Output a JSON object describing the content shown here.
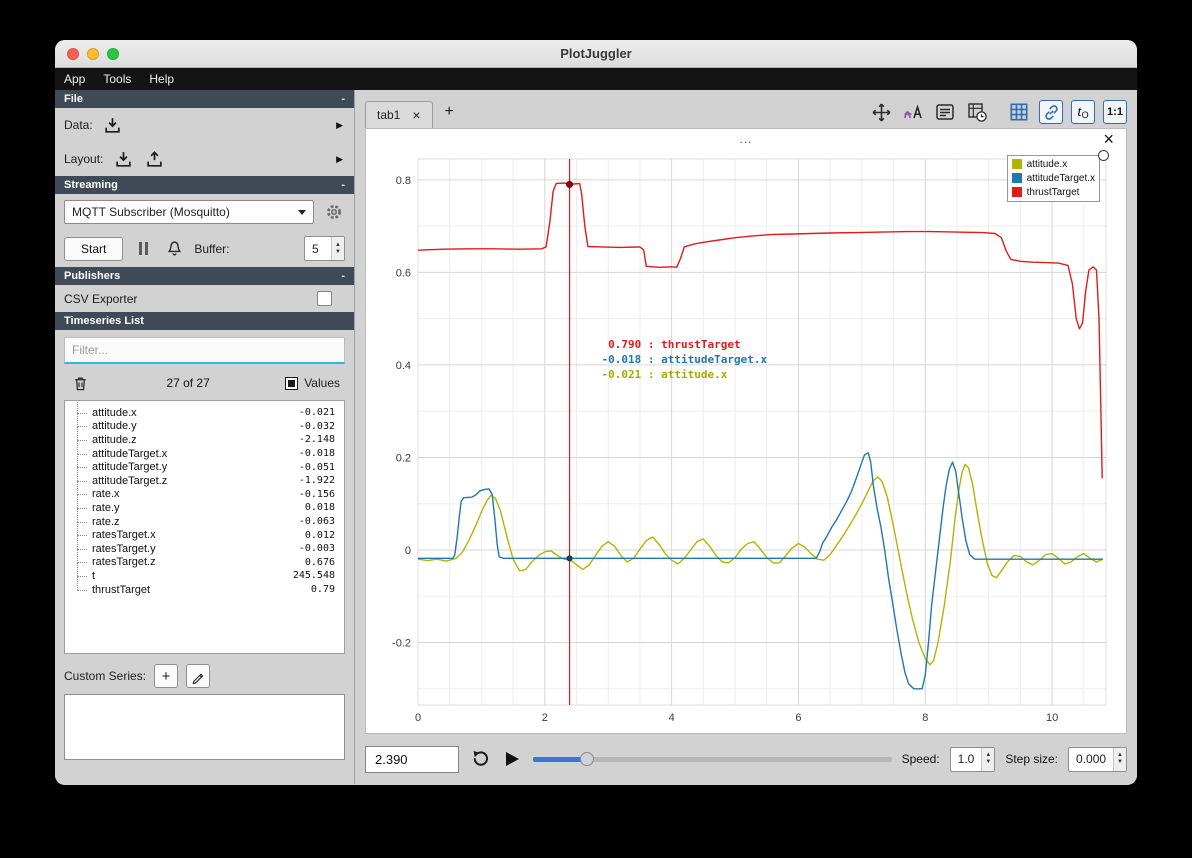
{
  "window": {
    "title": "PlotJuggler",
    "menu_items": [
      "App",
      "Tools",
      "Help"
    ]
  },
  "icons": {
    "close": "×",
    "plus": "+",
    "expander": "▶",
    "spin_up": "▲",
    "spin_down": "▼"
  },
  "sidebar": {
    "sections": {
      "file": {
        "title": "File",
        "collapse": "-"
      },
      "streaming": {
        "title": "Streaming",
        "collapse": "-"
      },
      "publishers": {
        "title": "Publishers",
        "collapse": "-"
      },
      "timeseries": {
        "title": "Timeseries List"
      }
    },
    "file": {
      "data_label": "Data:",
      "layout_label": "Layout:"
    },
    "streaming": {
      "source_selected": "MQTT Subscriber (Mosquitto)",
      "start_button": "Start",
      "buffer_label": "Buffer:",
      "buffer_value": "5"
    },
    "publishers": {
      "csv_exporter_label": "CSV Exporter"
    },
    "timeseries": {
      "filter_placeholder": "Filter...",
      "count_text": "27 of 27",
      "values_label": "Values",
      "items": [
        {
          "name": "attitude.x",
          "value": "-0.021"
        },
        {
          "name": "attitude.y",
          "value": "-0.032"
        },
        {
          "name": "attitude.z",
          "value": "-2.148"
        },
        {
          "name": "attitudeTarget.x",
          "value": "-0.018"
        },
        {
          "name": "attitudeTarget.y",
          "value": "-0.051"
        },
        {
          "name": "attitudeTarget.z",
          "value": "-1.922"
        },
        {
          "name": "rate.x",
          "value": "-0.156"
        },
        {
          "name": "rate.y",
          "value": "0.018"
        },
        {
          "name": "rate.z",
          "value": "-0.063"
        },
        {
          "name": "ratesTarget.x",
          "value": "0.012"
        },
        {
          "name": "ratesTarget.y",
          "value": "-0.003"
        },
        {
          "name": "ratesTarget.z",
          "value": "0.676"
        },
        {
          "name": "t",
          "value": "245.548"
        },
        {
          "name": "thrustTarget",
          "value": "0.79"
        }
      ],
      "custom_series_label": "Custom Series:"
    }
  },
  "main": {
    "tabs": [
      {
        "label": "tab1"
      }
    ],
    "new_tab_label": "+",
    "toolbar": {
      "icon_names": [
        "pan-zoom",
        "text-style",
        "legend",
        "datetime",
        "grid",
        "link",
        "time-offset",
        "aspect-ratio"
      ],
      "t0_label": "t",
      "t0_sub": "O",
      "ratio_label": "1:1",
      "accent_color": "#2f6db8"
    },
    "plot": {
      "header_dots": "...",
      "legend": [
        {
          "label": "attitude.x",
          "color": "#b2b400"
        },
        {
          "label": "attitudeTarget.x",
          "color": "#1f77b4"
        },
        {
          "label": "thrustTarget",
          "color": "#e01b1b"
        }
      ],
      "tracker": {
        "time": 2.39,
        "readouts": [
          {
            "value": "0.790",
            "name": "thrustTarget",
            "color": "#e01b1b"
          },
          {
            "value": "-0.018",
            "name": "attitudeTarget.x",
            "color": "#1f77b4"
          },
          {
            "value": "-0.021",
            "name": "attitude.x",
            "color": "#a8aa00"
          }
        ]
      }
    }
  },
  "bottom_bar": {
    "time_value": "2.390",
    "speed_label": "Speed:",
    "speed_value": "1.0",
    "step_label": "Step size:",
    "step_value": "0.000"
  },
  "chart_data": {
    "type": "line",
    "title": "",
    "xlabel": "",
    "ylabel": "",
    "xlim": [
      0,
      10.85
    ],
    "ylim": [
      -0.335,
      0.845
    ],
    "x_ticks": [
      0,
      2,
      4,
      6,
      8,
      10
    ],
    "y_ticks": [
      -0.2,
      0,
      0.2,
      0.4,
      0.6,
      0.8
    ],
    "grid": true,
    "legend_position": "top-right",
    "tracker_x": 2.39,
    "tracker_dots": [
      {
        "y": 0.79,
        "fill": "#a40000",
        "stroke": "#5c0000",
        "r": 3
      },
      {
        "y": -0.018,
        "fill": "#16456e",
        "stroke": "#0c2c49",
        "r": 2.5
      }
    ],
    "series": [
      {
        "name": "attitude.x",
        "color": "#b2b400",
        "points": [
          [
            0,
            -0.02
          ],
          [
            0.15,
            -0.023
          ],
          [
            0.3,
            -0.02
          ],
          [
            0.45,
            -0.024
          ],
          [
            0.6,
            -0.018
          ],
          [
            0.7,
            -0.005
          ],
          [
            0.8,
            0.02
          ],
          [
            0.9,
            0.05
          ],
          [
            1.0,
            0.082
          ],
          [
            1.08,
            0.105
          ],
          [
            1.15,
            0.118
          ],
          [
            1.22,
            0.112
          ],
          [
            1.3,
            0.085
          ],
          [
            1.4,
            0.03
          ],
          [
            1.5,
            -0.02
          ],
          [
            1.6,
            -0.045
          ],
          [
            1.7,
            -0.042
          ],
          [
            1.8,
            -0.025
          ],
          [
            1.9,
            -0.012
          ],
          [
            2.0,
            -0.004
          ],
          [
            2.1,
            -0.002
          ],
          [
            2.2,
            -0.012
          ],
          [
            2.3,
            -0.02
          ],
          [
            2.4,
            -0.021
          ],
          [
            2.5,
            -0.032
          ],
          [
            2.6,
            -0.042
          ],
          [
            2.7,
            -0.032
          ],
          [
            2.8,
            -0.012
          ],
          [
            2.9,
            0.008
          ],
          [
            3.0,
            0.018
          ],
          [
            3.1,
            0.008
          ],
          [
            3.2,
            -0.012
          ],
          [
            3.3,
            -0.026
          ],
          [
            3.4,
            -0.018
          ],
          [
            3.5,
            0.002
          ],
          [
            3.6,
            0.02
          ],
          [
            3.7,
            0.028
          ],
          [
            3.8,
            0.012
          ],
          [
            3.9,
            -0.008
          ],
          [
            4.0,
            -0.022
          ],
          [
            4.1,
            -0.03
          ],
          [
            4.2,
            -0.018
          ],
          [
            4.3,
            0.0
          ],
          [
            4.4,
            0.018
          ],
          [
            4.5,
            0.024
          ],
          [
            4.6,
            0.008
          ],
          [
            4.7,
            -0.012
          ],
          [
            4.8,
            -0.026
          ],
          [
            4.9,
            -0.028
          ],
          [
            5.0,
            -0.016
          ],
          [
            5.1,
            0.002
          ],
          [
            5.2,
            0.014
          ],
          [
            5.3,
            0.018
          ],
          [
            5.4,
            0.002
          ],
          [
            5.5,
            -0.016
          ],
          [
            5.6,
            -0.028
          ],
          [
            5.7,
            -0.028
          ],
          [
            5.8,
            -0.012
          ],
          [
            5.9,
            0.004
          ],
          [
            6.0,
            0.014
          ],
          [
            6.1,
            0.006
          ],
          [
            6.2,
            -0.008
          ],
          [
            6.3,
            -0.02
          ],
          [
            6.4,
            -0.022
          ],
          [
            6.5,
            -0.01
          ],
          [
            6.6,
            0.01
          ],
          [
            6.7,
            0.03
          ],
          [
            6.8,
            0.052
          ],
          [
            6.9,
            0.075
          ],
          [
            7.0,
            0.1
          ],
          [
            7.1,
            0.128
          ],
          [
            7.18,
            0.15
          ],
          [
            7.25,
            0.158
          ],
          [
            7.32,
            0.148
          ],
          [
            7.4,
            0.115
          ],
          [
            7.5,
            0.05
          ],
          [
            7.6,
            -0.02
          ],
          [
            7.7,
            -0.09
          ],
          [
            7.8,
            -0.15
          ],
          [
            7.9,
            -0.2
          ],
          [
            8.0,
            -0.235
          ],
          [
            8.07,
            -0.248
          ],
          [
            8.13,
            -0.24
          ],
          [
            8.2,
            -0.2
          ],
          [
            8.3,
            -0.12
          ],
          [
            8.4,
            -0.02
          ],
          [
            8.47,
            0.07
          ],
          [
            8.53,
            0.13
          ],
          [
            8.58,
            0.168
          ],
          [
            8.63,
            0.185
          ],
          [
            8.68,
            0.178
          ],
          [
            8.75,
            0.14
          ],
          [
            8.82,
            0.08
          ],
          [
            8.9,
            0.02
          ],
          [
            8.98,
            -0.03
          ],
          [
            9.05,
            -0.055
          ],
          [
            9.12,
            -0.06
          ],
          [
            9.2,
            -0.045
          ],
          [
            9.3,
            -0.025
          ],
          [
            9.4,
            -0.012
          ],
          [
            9.5,
            -0.014
          ],
          [
            9.6,
            -0.026
          ],
          [
            9.7,
            -0.032
          ],
          [
            9.8,
            -0.022
          ],
          [
            9.9,
            -0.01
          ],
          [
            10.0,
            -0.008
          ],
          [
            10.1,
            -0.018
          ],
          [
            10.2,
            -0.03
          ],
          [
            10.3,
            -0.026
          ],
          [
            10.4,
            -0.014
          ],
          [
            10.5,
            -0.008
          ],
          [
            10.6,
            -0.018
          ],
          [
            10.7,
            -0.026
          ],
          [
            10.8,
            -0.02
          ]
        ]
      },
      {
        "name": "attitudeTarget.x",
        "color": "#1f77b4",
        "points": [
          [
            0,
            -0.018
          ],
          [
            0.55,
            -0.018
          ],
          [
            0.58,
            -0.01
          ],
          [
            0.62,
            0.03
          ],
          [
            0.65,
            0.07
          ],
          [
            0.68,
            0.105
          ],
          [
            0.72,
            0.113
          ],
          [
            0.85,
            0.114
          ],
          [
            0.92,
            0.12
          ],
          [
            0.98,
            0.128
          ],
          [
            1.05,
            0.131
          ],
          [
            1.12,
            0.132
          ],
          [
            1.17,
            0.12
          ],
          [
            1.21,
            0.07
          ],
          [
            1.25,
            0.01
          ],
          [
            1.28,
            -0.015
          ],
          [
            1.35,
            -0.018
          ],
          [
            2.5,
            -0.018
          ],
          [
            4.0,
            -0.018
          ],
          [
            5.5,
            -0.018
          ],
          [
            6.28,
            -0.018
          ],
          [
            6.33,
            -0.005
          ],
          [
            6.38,
            0.015
          ],
          [
            6.45,
            0.03
          ],
          [
            6.52,
            0.048
          ],
          [
            6.6,
            0.065
          ],
          [
            6.68,
            0.085
          ],
          [
            6.76,
            0.105
          ],
          [
            6.84,
            0.128
          ],
          [
            6.92,
            0.158
          ],
          [
            6.98,
            0.182
          ],
          [
            7.04,
            0.205
          ],
          [
            7.1,
            0.21
          ],
          [
            7.14,
            0.19
          ],
          [
            7.18,
            0.14
          ],
          [
            7.24,
            0.09
          ],
          [
            7.3,
            0.05
          ],
          [
            7.36,
            0.0
          ],
          [
            7.42,
            -0.06
          ],
          [
            7.48,
            -0.11
          ],
          [
            7.55,
            -0.17
          ],
          [
            7.62,
            -0.225
          ],
          [
            7.68,
            -0.265
          ],
          [
            7.74,
            -0.29
          ],
          [
            7.82,
            -0.3
          ],
          [
            7.95,
            -0.3
          ],
          [
            8.0,
            -0.27
          ],
          [
            8.05,
            -0.2
          ],
          [
            8.1,
            -0.12
          ],
          [
            8.16,
            -0.05
          ],
          [
            8.22,
            0.02
          ],
          [
            8.28,
            0.09
          ],
          [
            8.33,
            0.14
          ],
          [
            8.38,
            0.175
          ],
          [
            8.43,
            0.19
          ],
          [
            8.48,
            0.17
          ],
          [
            8.53,
            0.12
          ],
          [
            8.58,
            0.07
          ],
          [
            8.64,
            0.02
          ],
          [
            8.7,
            -0.01
          ],
          [
            8.78,
            -0.02
          ],
          [
            9.5,
            -0.02
          ],
          [
            10.2,
            -0.02
          ],
          [
            10.8,
            -0.02
          ]
        ]
      },
      {
        "name": "thrustTarget",
        "color": "#e01b1b",
        "points": [
          [
            0,
            0.648
          ],
          [
            0.4,
            0.65
          ],
          [
            0.8,
            0.651
          ],
          [
            1.2,
            0.651
          ],
          [
            1.6,
            0.65
          ],
          [
            1.95,
            0.651
          ],
          [
            2.02,
            0.655
          ],
          [
            2.08,
            0.71
          ],
          [
            2.13,
            0.775
          ],
          [
            2.18,
            0.792
          ],
          [
            2.3,
            0.793
          ],
          [
            2.45,
            0.791
          ],
          [
            2.55,
            0.792
          ],
          [
            2.58,
            0.77
          ],
          [
            2.63,
            0.7
          ],
          [
            2.68,
            0.656
          ],
          [
            2.9,
            0.655
          ],
          [
            3.2,
            0.654
          ],
          [
            3.5,
            0.655
          ],
          [
            3.56,
            0.648
          ],
          [
            3.6,
            0.613
          ],
          [
            3.8,
            0.611
          ],
          [
            4.0,
            0.612
          ],
          [
            4.08,
            0.611
          ],
          [
            4.14,
            0.63
          ],
          [
            4.2,
            0.655
          ],
          [
            4.35,
            0.661
          ],
          [
            4.55,
            0.666
          ],
          [
            4.75,
            0.67
          ],
          [
            5.0,
            0.675
          ],
          [
            5.3,
            0.679
          ],
          [
            5.6,
            0.682
          ],
          [
            5.9,
            0.683
          ],
          [
            6.2,
            0.684
          ],
          [
            6.5,
            0.685
          ],
          [
            6.9,
            0.686
          ],
          [
            7.3,
            0.687
          ],
          [
            7.7,
            0.688
          ],
          [
            8.1,
            0.688
          ],
          [
            8.5,
            0.687
          ],
          [
            8.9,
            0.686
          ],
          [
            9.1,
            0.684
          ],
          [
            9.2,
            0.675
          ],
          [
            9.28,
            0.645
          ],
          [
            9.35,
            0.628
          ],
          [
            9.5,
            0.624
          ],
          [
            9.7,
            0.622
          ],
          [
            9.9,
            0.621
          ],
          [
            10.1,
            0.62
          ],
          [
            10.25,
            0.615
          ],
          [
            10.32,
            0.575
          ],
          [
            10.38,
            0.5
          ],
          [
            10.43,
            0.478
          ],
          [
            10.48,
            0.49
          ],
          [
            10.53,
            0.56
          ],
          [
            10.58,
            0.605
          ],
          [
            10.65,
            0.612
          ],
          [
            10.7,
            0.605
          ],
          [
            10.74,
            0.5
          ],
          [
            10.77,
            0.3
          ],
          [
            10.79,
            0.155
          ]
        ]
      }
    ]
  }
}
